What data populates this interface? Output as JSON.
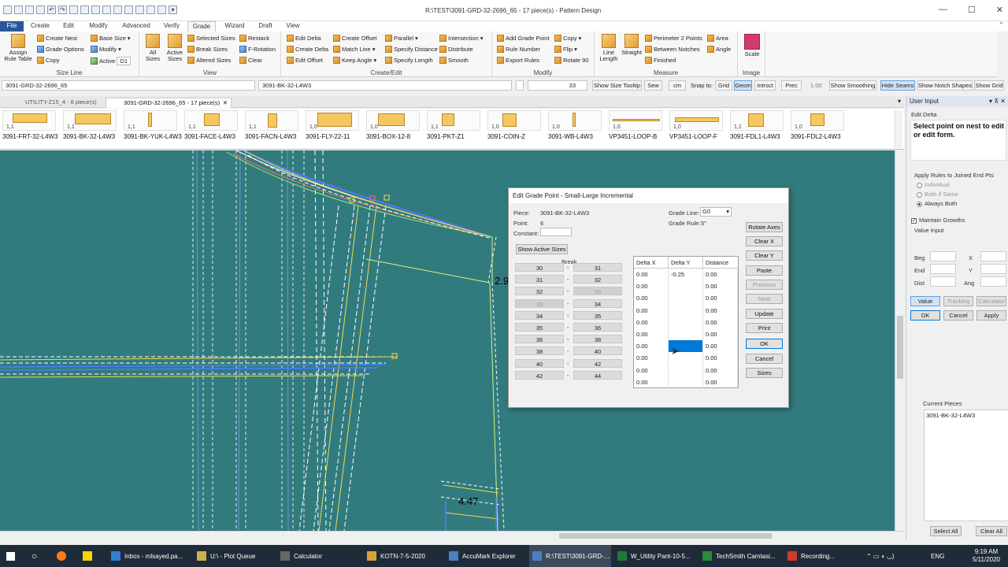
{
  "window": {
    "title": "R:\\TEST\\3091-GRD-32-2696_65  -  17 piece(s)  -  Pattern Design",
    "minimize": "—",
    "maximize": "☐",
    "close": "✕"
  },
  "menu": [
    "File",
    "Create",
    "Edit",
    "Modify",
    "Advanced",
    "Verify",
    "Grade",
    "Wizard",
    "Draft",
    "View"
  ],
  "ribbon": {
    "size_line": {
      "label": "Size Line",
      "assign": "Assign Rule Table",
      "create_nest": "Create Nest",
      "grade_options": "Grade Options",
      "copy": "Copy",
      "base_size": "Base Size",
      "modify": "Modify",
      "active": "Active",
      "active_value": "D1"
    },
    "view": {
      "label": "View",
      "all_sizes": "All Sizes",
      "active_sizes": "Active Sizes",
      "selected_sizes": "Selected Sizes",
      "break_sizes": "Break Sizes",
      "altered_sizes": "Altered Sizes",
      "restack": "Restack",
      "f_rotation": "F-Rotation",
      "clear": "Clear"
    },
    "create_edit": {
      "label": "Create/Edit",
      "edit_delta": "Edit Delta",
      "create_delta": "Create Delta",
      "edit_offset": "Edit Offset",
      "create_offset": "Create Offset",
      "match_line": "Match Line",
      "keep_angle": "Keep Angle",
      "parallel": "Parallel",
      "specify_distance": "Specify Distance",
      "specify_length": "Specify Length",
      "intersection": "Intersection",
      "distribute": "Distribute",
      "smooth": "Smooth"
    },
    "modify": {
      "label": "Modify",
      "add_grade_point": "Add Grade Point",
      "rule_number": "Rule Number",
      "export_rules": "Export Rules",
      "copy": "Copy",
      "flip": "Flip",
      "rotate_90": "Rotate 90"
    },
    "measure": {
      "label": "Measure",
      "line_length": "Line Length",
      "straight": "Straight",
      "perimeter": "Perimeter 2 Points",
      "between_notches": "Between Notches",
      "finished": "Finished",
      "area": "Area",
      "angle": "Angle"
    },
    "image": {
      "label": "Image",
      "scale": "Scale"
    }
  },
  "toolbar": {
    "field1": "3091-GRD-32-2696_65",
    "field2": "3091-BK-32-L4W3",
    "size_value": "33",
    "show_size_tooltip": "Show Size Tooltip",
    "sew": "Sew",
    "cm": "cm",
    "snap_to": "Snap to:",
    "grid": "Grid",
    "geom": "Geom",
    "intrsct": "Intrsct",
    "prec": "Prec",
    "prec_value": "1.00",
    "show_smoothing": "Show Smoothing",
    "hide_seams": "Hide Seams",
    "show_notch_shapes": "Show Notch Shapes",
    "show_grid": "Show Grid"
  },
  "doc_tabs": [
    {
      "label": "UTILITY-Z15_4  -  8 piece(s)"
    },
    {
      "label": "3091-GRD-32-2696_65  -  17 piece(s)"
    }
  ],
  "pieces": [
    {
      "size": "1,1",
      "name": "3091-FRT-32-L4W3"
    },
    {
      "size": "1,1",
      "name": "3091-BK-32-L4W3"
    },
    {
      "size": "1,1",
      "name": "3091-BK-YUK-L4W3"
    },
    {
      "size": "1,1",
      "name": "3091-FACE-L4W3"
    },
    {
      "size": "1,1",
      "name": "3091-FACN-L4W3"
    },
    {
      "size": "1,0",
      "name": "3091-FLY-22-11"
    },
    {
      "size": "1,0",
      "name": "3091-BOX-12-8"
    },
    {
      "size": "1,1",
      "name": "3091-PKT-Z1"
    },
    {
      "size": "1,0",
      "name": "3091-COIN-Z"
    },
    {
      "size": "1,0",
      "name": "3091-WB-L4W3"
    },
    {
      "size": "1,0",
      "name": "VP3451-LOOP-B"
    },
    {
      "size": "1,0",
      "name": "VP3451-LOOP-F"
    },
    {
      "size": "1,1",
      "name": "3091-FDL1-L4W3"
    },
    {
      "size": "1,0",
      "name": "3091-FDL2-L4W3"
    }
  ],
  "canvas": {
    "label_a": "2.9",
    "label_b": "4.47"
  },
  "dialog": {
    "title": "Edit Grade Point - Small-Large Incremental",
    "piece_label": "Piece:",
    "piece_value": "3091-BK-32-L4W3",
    "point_label": "Point:",
    "point_value": "6",
    "constant_label": "Constant:",
    "grade_line_label": "Grade Line:",
    "grade_line_value": "G0",
    "grade_rule_label": "Grade Rule:",
    "grade_rule_value": "5\"",
    "show_active_sizes": "Show Active Sizes",
    "break_header": "Break",
    "col_dx": "Delta X",
    "col_dy": "Delta Y",
    "col_dist": "Distance",
    "rows": [
      {
        "from": "30",
        "to": "31",
        "dx": "0.00",
        "dy": "-0.25",
        "dist": "0.00"
      },
      {
        "from": "31",
        "to": "32",
        "dx": "0.00",
        "dy": "",
        "dist": "0.00"
      },
      {
        "from": "32",
        "to": "33",
        "dx": "0.00",
        "dy": "",
        "dist": "0.00"
      },
      {
        "from": "33",
        "to": "34",
        "dx": "0.00",
        "dy": "",
        "dist": "0.00"
      },
      {
        "from": "34",
        "to": "35",
        "dx": "0.00",
        "dy": "",
        "dist": "0.00"
      },
      {
        "from": "35",
        "to": "36",
        "dx": "0.00",
        "dy": "",
        "dist": "0.00"
      },
      {
        "from": "36",
        "to": "38",
        "dx": "0.00",
        "dy": "",
        "dist": "0.00"
      },
      {
        "from": "38",
        "to": "40",
        "dx": "0.00",
        "dy": "",
        "dist": "0.00"
      },
      {
        "from": "40",
        "to": "42",
        "dx": "0.00",
        "dy": "",
        "dist": "0.00"
      },
      {
        "from": "42",
        "to": "44",
        "dx": "0.00",
        "dy": "",
        "dist": "0.00"
      }
    ],
    "dash": "-",
    "buttons": {
      "rotate_axes": "Rotate Axes",
      "clear_x": "Clear X",
      "clear_y": "Clear Y",
      "paste": "Paste",
      "previous": "Previous",
      "next": "Next",
      "update": "Update",
      "print": "Print",
      "ok": "OK",
      "cancel": "Cancel",
      "sizes": "Sizes"
    }
  },
  "user_input": {
    "title": "User Input",
    "section": "Edit Delta",
    "prompt": "Select point on nest to edit or edit form.",
    "apply_rules": "Apply Rules to Joined End Pts",
    "individual": "Individual",
    "both_if_same": "Both if Same",
    "always_both": "Always Both",
    "maintain_growths": "Maintain Growths",
    "value_input": "Value Input",
    "beg": "Beg",
    "end": "End",
    "dist": "Dist",
    "x": "X",
    "y": "Y",
    "ang": "Ang",
    "value": "Value",
    "tracking": "Tracking",
    "calculator": "Calculator",
    "ok": "OK",
    "cancel": "Cancel",
    "apply": "Apply",
    "current_pieces": "Current Pieces",
    "current_piece_item": "3091-BK-32-L4W3",
    "select_all": "Select All",
    "clear_all": "Clear All"
  },
  "taskbar": {
    "items": [
      "Inbox - mlsayed.pa...",
      "U:\\ - Plot Queue",
      "Calculator",
      "KOTN-7-5-2020",
      "AccuMark Explorer",
      "R:\\TEST\\3091-GRD-...",
      "W_Utility Pant-10-5...",
      "TechSmith Camtasi...",
      "Recording..."
    ],
    "lang": "ENG",
    "time": "9:19 AM",
    "date": "5/11/2020"
  },
  "colors": {
    "canvas_bg": "#317b7e",
    "accent": "#2b579a",
    "selection": "#0078d7"
  }
}
